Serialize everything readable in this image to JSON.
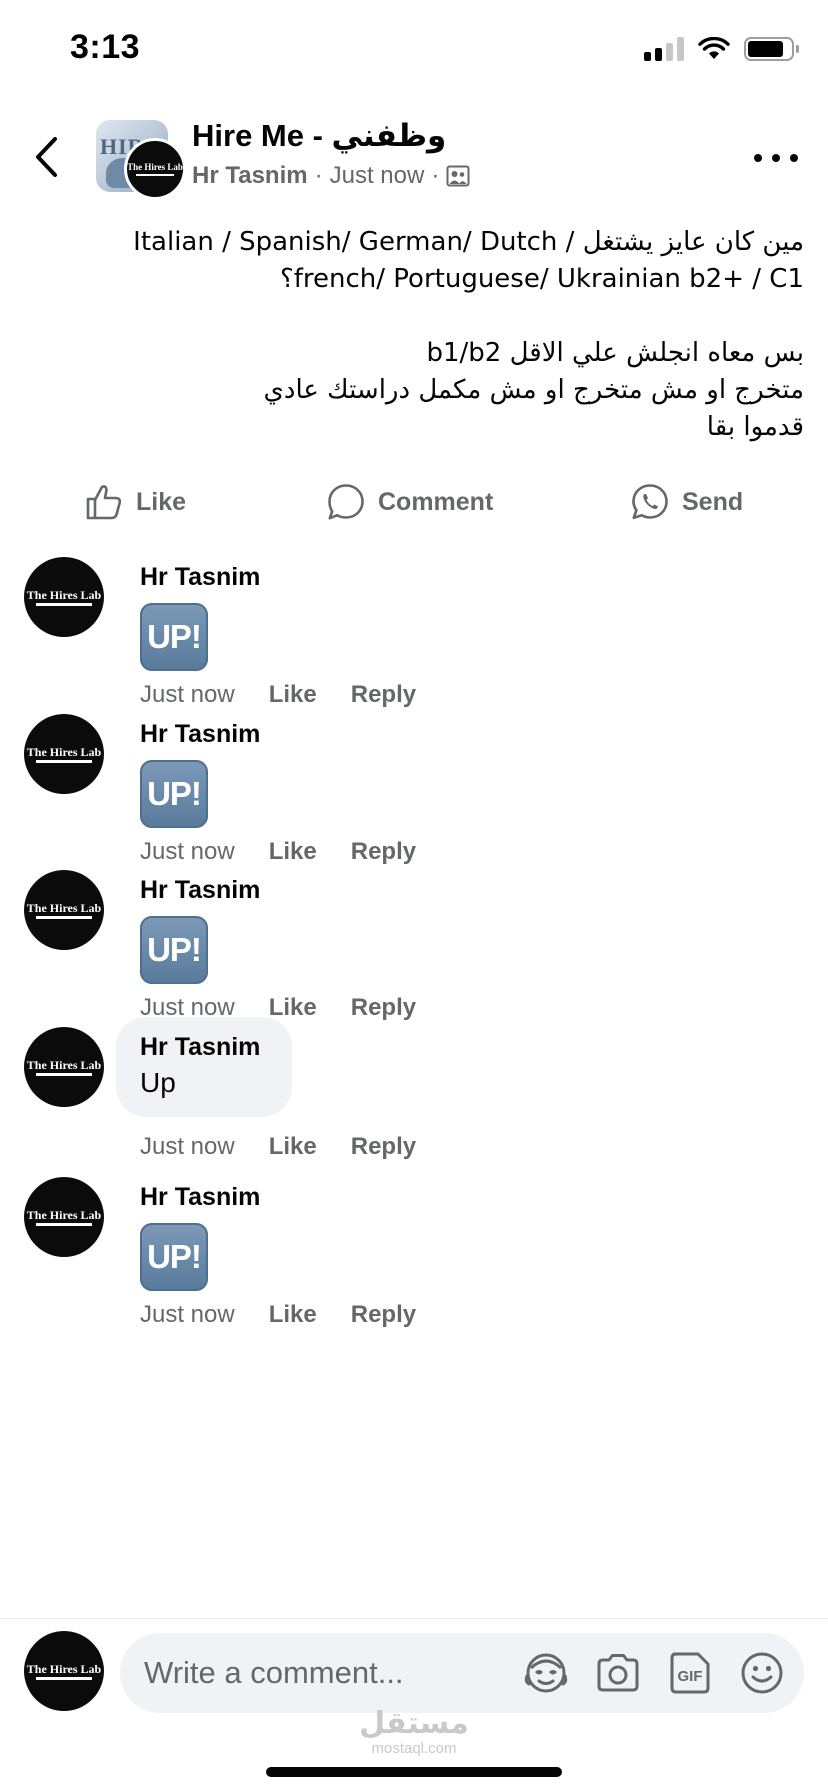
{
  "status_bar": {
    "time": "3:13",
    "battery_level": 0.85,
    "signal_bars_active": 2,
    "signal_bars_total": 4,
    "icons": [
      "cellular-signal-icon",
      "wifi-icon",
      "battery-icon"
    ]
  },
  "header": {
    "back_icon": "chevron-left-icon",
    "group_name": "Hire Me - وظفني",
    "group_avatar_letters": "HIRE",
    "author": "Hr Tasnim",
    "time": "Just now",
    "separator": "·",
    "audience_icon": "group-audience-icon",
    "more_icon": "more-horizontal-icon"
  },
  "brand_logo": {
    "name": "The Hires Lab"
  },
  "post": {
    "lines": [
      "مين كان عايز يشتغل / Italian / Spanish/ German/ Dutch",
      "french/ Portuguese/ Ukrainian b2+ / C1؟",
      "",
      "بس معاه انجلش علي الاقل b1/b2",
      "متخرج او مش متخرج او مش مكمل دراستك عادي",
      "قدموا بقا"
    ]
  },
  "actions": {
    "like": "Like",
    "comment": "Comment",
    "send": "Send",
    "icons": [
      "thumbs-up-icon",
      "comment-bubble-icon",
      "whatsapp-icon"
    ]
  },
  "comments": [
    {
      "author": "Hr Tasnim",
      "kind": "emoji",
      "content": "UP!",
      "time": "Just now",
      "like": "Like",
      "reply": "Reply"
    },
    {
      "author": "Hr Tasnim",
      "kind": "emoji",
      "content": "UP!",
      "time": "Just now",
      "like": "Like",
      "reply": "Reply"
    },
    {
      "author": "Hr Tasnim",
      "kind": "emoji",
      "content": "UP!",
      "time": "Just now",
      "like": "Like",
      "reply": "Reply"
    },
    {
      "author": "Hr Tasnim",
      "kind": "text",
      "content": "Up",
      "time": "Just now",
      "like": "Like",
      "reply": "Reply"
    },
    {
      "author": "Hr Tasnim",
      "kind": "emoji",
      "content": "UP!",
      "time": "Just now",
      "like": "Like",
      "reply": "Reply"
    }
  ],
  "composer": {
    "placeholder": "Write a comment...",
    "icons": [
      "avatar-sticker-icon",
      "camera-icon",
      "gif-icon",
      "emoji-icon"
    ],
    "gif_label": "GIF"
  },
  "watermark": {
    "arabic": "مستقل",
    "latin": "mostaql.com"
  },
  "colors": {
    "primary_text": "#050505",
    "secondary_text": "#65676b",
    "bubble_bg": "#f0f2f5",
    "emoji_blue": "#6b8bab",
    "logo_bg": "#0b0b0b"
  }
}
